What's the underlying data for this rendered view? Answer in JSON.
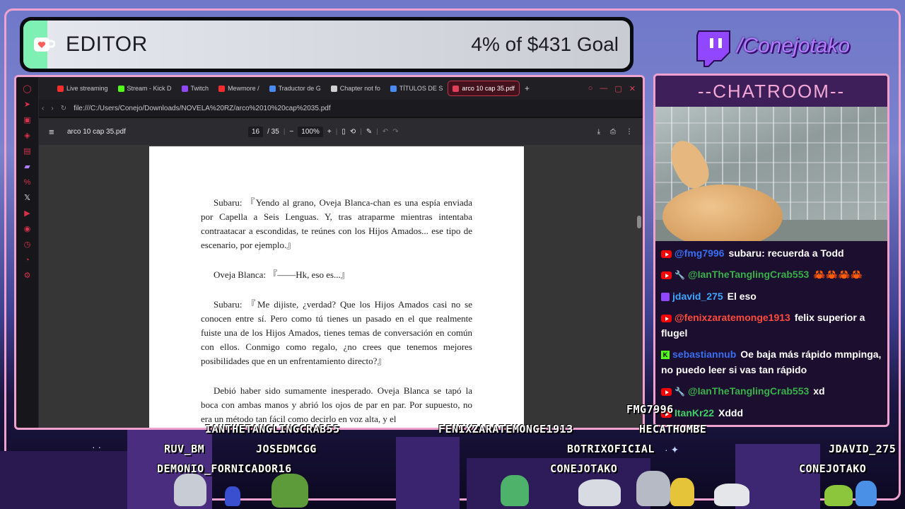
{
  "goal": {
    "title": "EDITOR",
    "amount_text": "4% of $431 Goal",
    "progress_percent": 4
  },
  "channel": {
    "handle": "/Conejotako"
  },
  "browser": {
    "tabs": [
      {
        "label": "Live streaming",
        "icon": "youtube-icon",
        "color": "#ff2d2d"
      },
      {
        "label": "Stream - Kick D",
        "icon": "kick-icon",
        "color": "#53fc18"
      },
      {
        "label": "Twitch",
        "icon": "twitch-icon",
        "color": "#9146ff"
      },
      {
        "label": "Mewmore /",
        "icon": "youtube-icon",
        "color": "#ff2d2d"
      },
      {
        "label": "Traductor de G",
        "icon": "translate-icon",
        "color": "#4a8af4"
      },
      {
        "label": "Chapter not fo",
        "icon": "page-icon",
        "color": "#d0d0d0"
      },
      {
        "label": "TÍTULOS DE S",
        "icon": "doc-icon",
        "color": "#4a8af4"
      },
      {
        "label": "arco 10 cap 35.pdf",
        "icon": "pdf-icon",
        "color": "#e0405a"
      }
    ],
    "url": "file:///C:/Users/Conejo/Downloads/NOVELA%20RZ/arco%2010%20cap%2035.pdf"
  },
  "pdf": {
    "filename": "arco 10 cap 35.pdf",
    "page_current": "16",
    "page_total": "/ 35",
    "zoom": "100%",
    "paragraphs": [
      "Subaru: 『Yendo al grano, Oveja Blanca-chan es una espía enviada por Capella a Seis Lenguas. Y, tras atraparme mientras intentaba contraatacar a escondidas, te reúnes con los Hijos Amados... ese tipo de escenario, por ejemplo.』",
      "Oveja Blanca: 『——Hk, eso es...』",
      "Subaru: 『Me dijiste, ¿verdad? Que los Hijos Amados casi no se conocen entre sí. Pero como tú tienes un pasado en el que realmente fuiste una de los Hijos Amados, tienes temas de conversación en común con ellos. Conmigo como regalo, ¿no crees que tenemos mejores posibilidades que en un enfrentamiento directo?』",
      "Debió haber sido sumamente inesperado. Oveja Blanca se tapó la boca con ambas manos y abrió los ojos de par en par. Por supuesto, no era un método tan fácil como decirlo en voz alta, y el"
    ]
  },
  "chat": {
    "title": "--CHATROOM--",
    "messages": [
      {
        "user": "@fmg7996",
        "text": "subaru: recuerda a Todd",
        "user_color": "#3a6ff2",
        "platform": "youtube"
      },
      {
        "user": "@IanTheTanglingCrab553",
        "text": "🦀🦀🦀🦀",
        "user_color": "#39b04a",
        "platform": "youtube"
      },
      {
        "user": "jdavid_275",
        "text": "El eso",
        "user_color": "#3fa6ff",
        "platform": "twitch"
      },
      {
        "user": "@fenixzaratemonge1913",
        "text": "felix superior a flugel",
        "user_color": "#ff4a3d",
        "platform": "youtube"
      },
      {
        "user": "sebastiannub",
        "text": "Oe baja más rápido mmpinga, no puedo leer si vas tan rápido",
        "user_color": "#3a6ff2",
        "platform": "kick"
      },
      {
        "user": "@IanTheTanglingCrab553",
        "text": "xd",
        "user_color": "#39b04a",
        "platform": "youtube"
      },
      {
        "user": "ItanKr22",
        "text": "Xddd",
        "user_color": "#3fd06a",
        "platform": "youtube"
      }
    ]
  },
  "stage_names": [
    "FMG7996",
    "IANTHETANGLINGCRAB55",
    "FENIXZARATEMONGE1913",
    "HECATHOMBE",
    "RUV_BM",
    "JOSEDMCGG",
    "BOTRIXOFICIAL",
    "JDAVID_275",
    "DEMONIO_FORNICADOR16",
    "CONEJOTAKO",
    "CONEJOTAKO"
  ],
  "colors": {
    "accent_pink": "#f0a2cf",
    "twitch_purple": "#9146ff",
    "goal_fill": "#7ef0b3"
  }
}
